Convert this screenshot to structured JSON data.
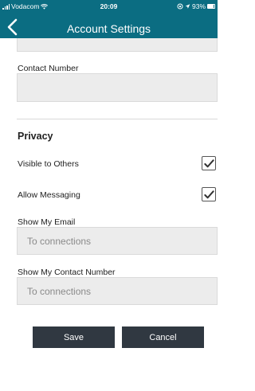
{
  "status_bar": {
    "carrier": "Vodacom",
    "time": "20:09",
    "battery": "93%"
  },
  "header": {
    "title": "Account Settings"
  },
  "contact_number": {
    "label": "Contact Number",
    "value": ""
  },
  "privacy": {
    "title": "Privacy",
    "visible_to_others": {
      "label": "Visible to Others",
      "checked": true
    },
    "allow_messaging": {
      "label": "Allow Messaging",
      "checked": true
    },
    "show_my_email": {
      "label": "Show My Email",
      "value": "To connections"
    },
    "show_my_contact_number": {
      "label": "Show My Contact Number",
      "value": "To connections"
    }
  },
  "actions": {
    "save_label": "Save",
    "cancel_label": "Cancel"
  },
  "colors": {
    "header_bg": "#0b6d82",
    "button_bg": "#303841",
    "field_bg": "#ececec"
  }
}
